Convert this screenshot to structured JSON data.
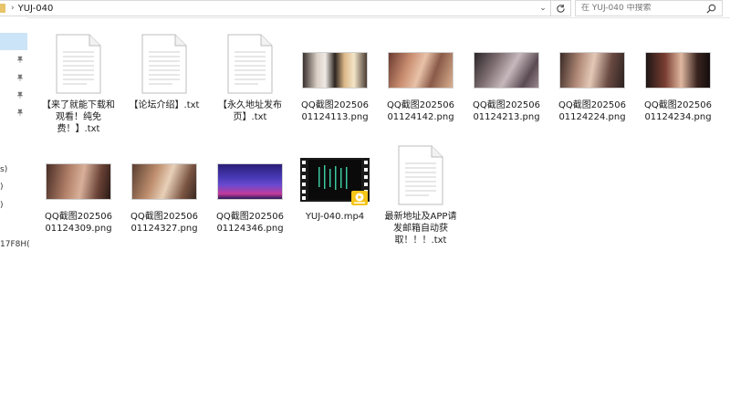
{
  "address": {
    "separator": "›",
    "folder": "YUJ-040",
    "dropdown": "⌄",
    "search_placeholder": "在 YUJ-040 中搜索"
  },
  "nav_fragments": [
    "s)",
    ")",
    ")",
    "17F8H("
  ],
  "items": [
    {
      "type": "txt",
      "label": "【来了就能下载和观看！纯免费！】.txt"
    },
    {
      "type": "txt",
      "label": "【论坛介绍】.txt"
    },
    {
      "type": "txt",
      "label": "【永久地址发布页】.txt"
    },
    {
      "type": "png",
      "label": "QQ截图20250601124113.png"
    },
    {
      "type": "png",
      "label": "QQ截图20250601124142.png"
    },
    {
      "type": "png",
      "label": "QQ截图20250601124213.png"
    },
    {
      "type": "png",
      "label": "QQ截图20250601124224.png"
    },
    {
      "type": "png",
      "label": "QQ截图20250601124234.png"
    },
    {
      "type": "png",
      "label": "QQ截图20250601124309.png"
    },
    {
      "type": "png",
      "label": "QQ截图20250601124327.png"
    },
    {
      "type": "png",
      "label": "QQ截图20250601124346.png"
    },
    {
      "type": "mp4",
      "label": "YUJ-040.mp4"
    },
    {
      "type": "txt",
      "label": "最新地址及APP请发邮箱自动获取！！！.txt"
    }
  ],
  "colors": {
    "selection": "#cce4f7",
    "folder": "#e8c46a",
    "player_badge": "#f5c518"
  }
}
